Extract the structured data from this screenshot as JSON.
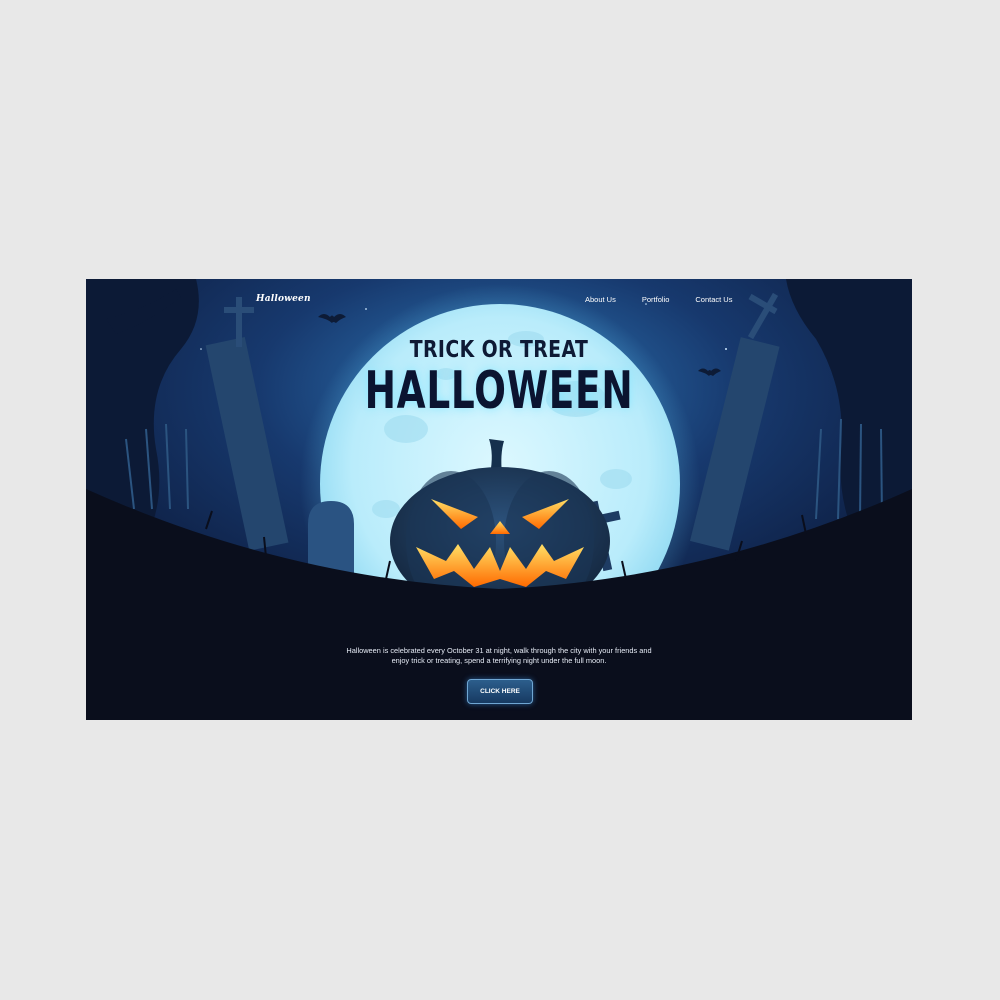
{
  "brand": {
    "logo_text": "Halloween"
  },
  "nav": {
    "items": [
      "About Us",
      "Portfolio",
      "Contact Us"
    ]
  },
  "hero": {
    "subtitle": "TRICK OR TREAT",
    "title": "HALLOWEEN",
    "description_line1": "Halloween is celebrated every October 31 at night, walk through the city with your friends and",
    "description_line2": "enjoy trick or treating, spend a terrifying night under the full moon.",
    "cta_label": "CLICK HERE"
  },
  "colors": {
    "page_background": "#e8e8e8",
    "sky": "#15305e",
    "moon": "#c7f2ff",
    "ground": "#0a0e1c",
    "pumpkin": "#1f3a5c",
    "pumpkin_glow": "#ff9a1a",
    "button": "#1f4a78"
  },
  "icons": [
    "bat-icon",
    "pumpkin-icon",
    "gravestone-icon",
    "cross-icon",
    "tree-icon"
  ]
}
